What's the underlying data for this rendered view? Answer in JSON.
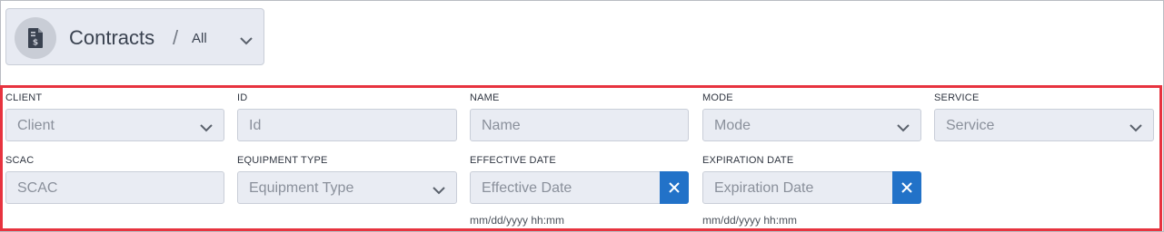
{
  "header": {
    "title": "Contracts",
    "separator": "/",
    "scope": "All",
    "icon": "contract-dollar-icon"
  },
  "filters": {
    "client": {
      "label": "CLIENT",
      "placeholder": "Client"
    },
    "id": {
      "label": "ID",
      "placeholder": "Id"
    },
    "name": {
      "label": "NAME",
      "placeholder": "Name"
    },
    "mode": {
      "label": "MODE",
      "placeholder": "Mode"
    },
    "service": {
      "label": "SERVICE",
      "placeholder": "Service"
    },
    "scac": {
      "label": "SCAC",
      "placeholder": "SCAC"
    },
    "equipment_type": {
      "label": "EQUIPMENT TYPE",
      "placeholder": "Equipment Type"
    },
    "effective_date": {
      "label": "EFFECTIVE DATE",
      "placeholder": "Effective Date",
      "format_hint": "mm/dd/yyyy hh:mm"
    },
    "expiration_date": {
      "label": "EXPIRATION DATE",
      "placeholder": "Expiration Date",
      "format_hint": "mm/dd/yyyy hh:mm"
    }
  },
  "colors": {
    "highlight_border": "#e7333f",
    "clear_button": "#2272c8",
    "field_bg": "#e9ecf3"
  }
}
